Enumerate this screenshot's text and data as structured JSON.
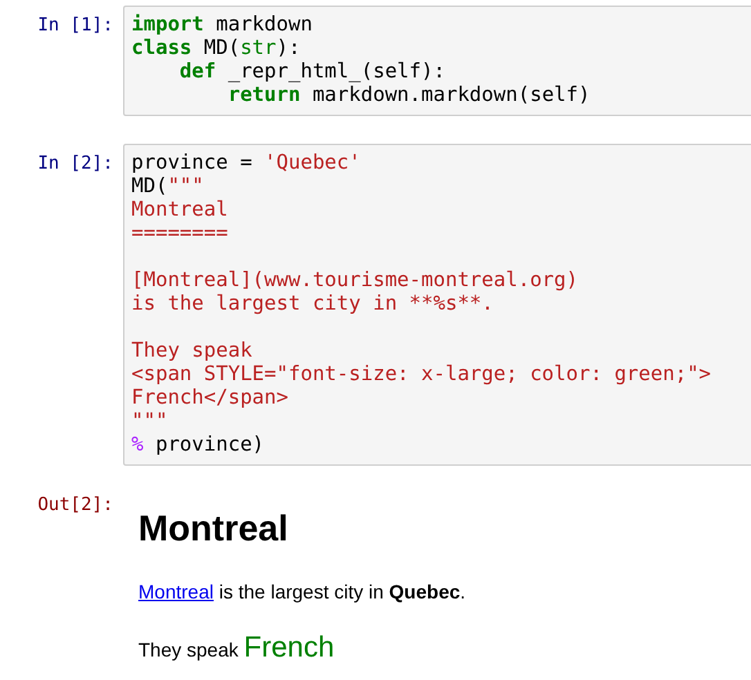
{
  "cells": [
    {
      "prompt": "In [1]:",
      "lines": [
        {
          "kind": "code",
          "tokens": [
            {
              "kind": "keyword",
              "text": "import"
            },
            {
              "kind": "plain",
              "text": " markdown"
            }
          ]
        },
        {
          "kind": "code",
          "tokens": [
            {
              "kind": "keyword",
              "text": "class"
            },
            {
              "kind": "plain",
              "text": " MD("
            },
            {
              "kind": "builtin",
              "text": "str"
            },
            {
              "kind": "plain",
              "text": "):"
            }
          ]
        },
        {
          "kind": "code",
          "tokens": [
            {
              "kind": "keyword",
              "text": "    def"
            },
            {
              "kind": "plain",
              "text": " _repr_html_(self):"
            }
          ]
        },
        {
          "kind": "code",
          "tokens": [
            {
              "kind": "keyword",
              "text": "        return"
            },
            {
              "kind": "plain",
              "text": " markdown.markdown(self)"
            }
          ]
        }
      ]
    },
    {
      "prompt": "In [2]:",
      "lines": [
        {
          "kind": "code",
          "tokens": [
            {
              "kind": "plain",
              "text": "province = "
            },
            {
              "kind": "string",
              "text": "'Quebec'"
            }
          ]
        },
        {
          "kind": "code",
          "tokens": [
            {
              "kind": "plain",
              "text": "MD("
            },
            {
              "kind": "string",
              "text": "\"\"\""
            }
          ]
        },
        {
          "kind": "code",
          "tokens": [
            {
              "kind": "string",
              "text": "Montreal"
            }
          ]
        },
        {
          "kind": "code",
          "tokens": [
            {
              "kind": "string",
              "text": "========"
            }
          ]
        },
        {
          "kind": "blank"
        },
        {
          "kind": "code",
          "tokens": [
            {
              "kind": "string",
              "text": "[Montreal](www.tourisme-montreal.org)"
            }
          ]
        },
        {
          "kind": "code",
          "tokens": [
            {
              "kind": "string",
              "text": "is the largest city in **%s**."
            }
          ]
        },
        {
          "kind": "blank"
        },
        {
          "kind": "code",
          "tokens": [
            {
              "kind": "string",
              "text": "They speak"
            }
          ]
        },
        {
          "kind": "code",
          "tokens": [
            {
              "kind": "string",
              "text": "<span STYLE=\"font-size: x-large; color: green;\">"
            }
          ]
        },
        {
          "kind": "code",
          "tokens": [
            {
              "kind": "string",
              "text": "French</span>"
            }
          ]
        },
        {
          "kind": "code",
          "tokens": [
            {
              "kind": "string",
              "text": "\"\"\""
            }
          ]
        },
        {
          "kind": "code",
          "tokens": [
            {
              "kind": "operator",
              "text": "%"
            },
            {
              "kind": "plain",
              "text": " province)"
            }
          ]
        }
      ]
    }
  ],
  "output": {
    "prompt": "Out[2]:",
    "heading": "Montreal",
    "paragraph": {
      "link": "Montreal",
      "text": " is the largest city in **Quebec**."
    },
    "speak": {
      "text": "They speak ",
      "large_text": "French"
    }
  }
}
